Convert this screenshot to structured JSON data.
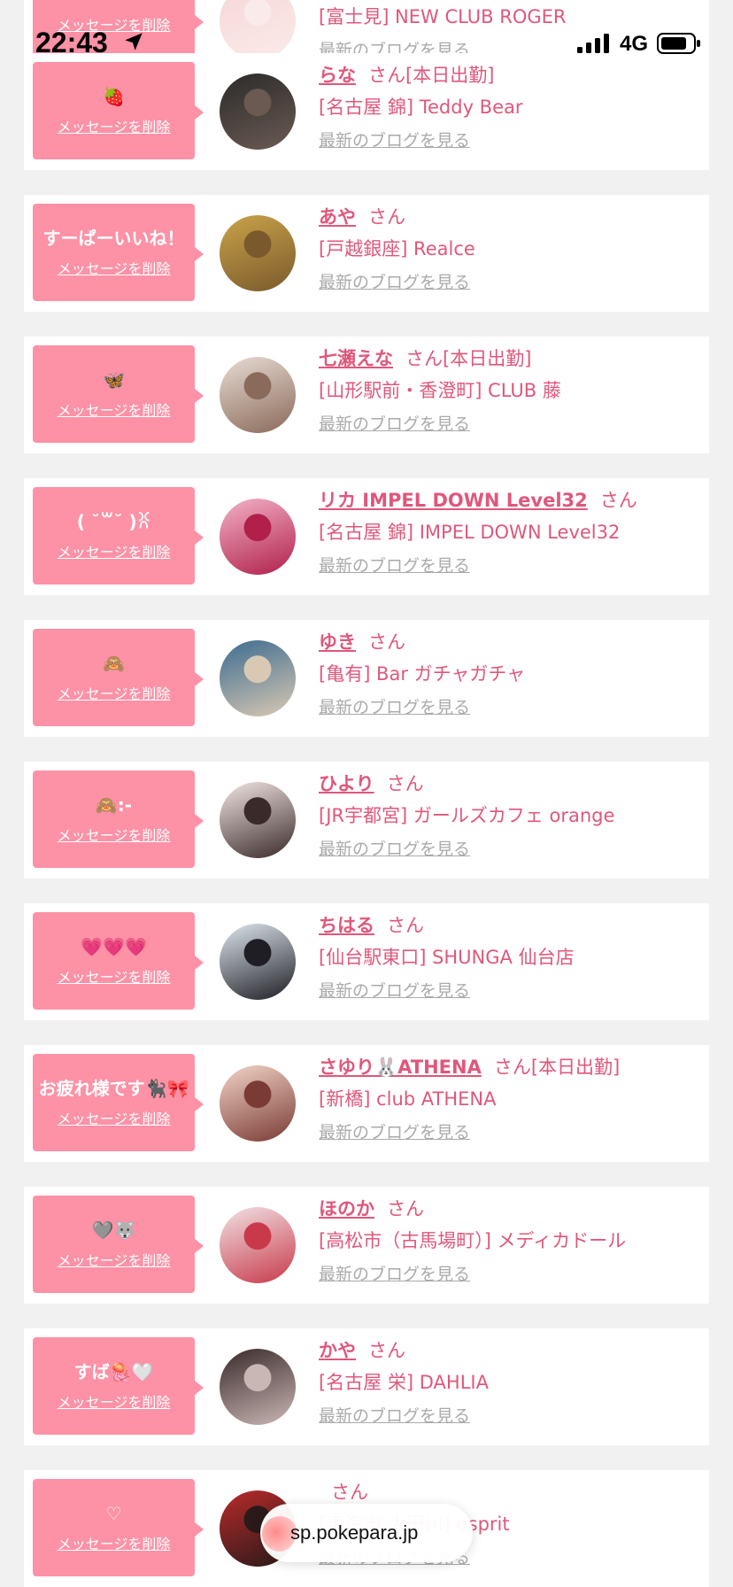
{
  "status_bar": {
    "time": "22:43",
    "network": "4G"
  },
  "url_bar": {
    "url": "sp.pokepara.jp"
  },
  "colors": {
    "accent": "#e0577b",
    "message_box": "#fd91a6",
    "muted_link": "#aaaaaa"
  },
  "common": {
    "delete_label": "メッセージを削除",
    "blog_label": "最新のブログを見る",
    "san": "さん"
  },
  "entries": [
    {
      "message": "",
      "name": "",
      "shift": "",
      "shop": "[富士見] NEW CLUB ROGER"
    },
    {
      "message": "🍓",
      "name": "らな",
      "shift": "[本日出勤]",
      "shop": "[名古屋 錦] Teddy Bear"
    },
    {
      "message": "すーぱーいいね！",
      "name": "あや",
      "shift": "",
      "shop": "[戸越銀座] Realce"
    },
    {
      "message": "🦋",
      "name": "七瀬えな",
      "shift": "[本日出勤]",
      "shop": "[山形駅前・香澄町] CLUB 藤"
    },
    {
      "message": "(  ˘꒳˘  )ꐦ",
      "name": "リカ IMPEL DOWN Level32",
      "shift": "",
      "shop": "[名古屋 錦] IMPEL DOWN Level32"
    },
    {
      "message": "🙈",
      "name": "ゆき",
      "shift": "",
      "shop": "[亀有] Bar ガチャガチャ"
    },
    {
      "message": "🙈:-",
      "name": "ひより",
      "shift": "",
      "shop": "[JR宇都宮] ガールズカフェ orange"
    },
    {
      "message": "💗💗💗",
      "name": "ちはる",
      "shift": "",
      "shop": "[仙台駅東口] SHUNGA 仙台店"
    },
    {
      "message": "お疲れ様です🐈‍⬛🎀",
      "name": "さゆり🐰ATHENA",
      "shift": "[本日出勤]",
      "shop": "[新橋] club ATHENA"
    },
    {
      "message": "🩶🐺",
      "name": "ほのか",
      "shift": "",
      "shop": "[高松市（古馬場町）] メディカドール"
    },
    {
      "message": "すば🪼🤍",
      "name": "かや",
      "shift": "",
      "shop": "[名古屋 栄] DAHLIA"
    },
    {
      "message": "♡",
      "name": "",
      "shift": "",
      "shop": "[東海市 太田川] esprit"
    }
  ],
  "avatars": [
    "avatar-photo-dark",
    "avatar-photo-blurred-face",
    "avatar-photo-pink-hair",
    "avatar-photo-mirror-selfie",
    "avatar-photo-pink-sticker",
    "avatar-photo-blue-door",
    "avatar-photo-cat-ears",
    "avatar-photo-snow",
    "avatar-photo-twin-tails",
    "avatar-photo-red-hat",
    "avatar-photo-ash-hair",
    "avatar-photo-red-dress"
  ]
}
